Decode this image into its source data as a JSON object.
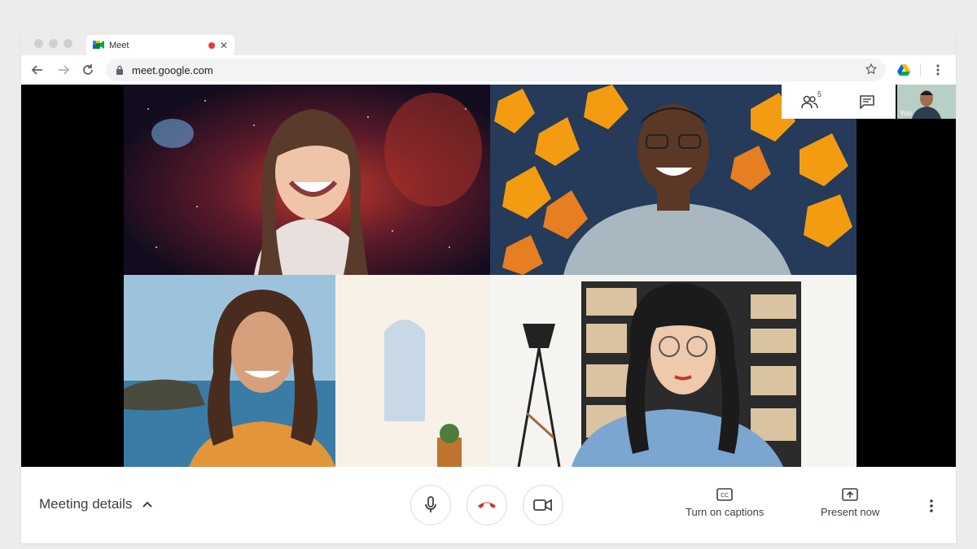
{
  "browser": {
    "tab_title": "Meet",
    "url": "meet.google.com"
  },
  "icons": {
    "back": "arrow-left-icon",
    "forward": "arrow-right-icon",
    "reload": "reload-icon",
    "lock": "lock-icon",
    "bookmark": "star-icon",
    "drive": "google-drive-icon",
    "menu": "kebab-menu-icon",
    "people": "people-icon",
    "chat": "chat-icon",
    "mic": "microphone-icon",
    "hangup": "phone-hangup-icon",
    "camera": "video-camera-icon",
    "captions": "closed-captions-icon",
    "present": "present-screen-icon"
  },
  "call": {
    "participant_count": "5",
    "self_label": "You"
  },
  "controls": {
    "meeting_details": "Meeting details",
    "captions_label": "Turn on captions",
    "present_label": "Present now"
  },
  "colors": {
    "hangup_red": "#d93025",
    "recording_red": "#e53935",
    "text": "#3c4043"
  }
}
